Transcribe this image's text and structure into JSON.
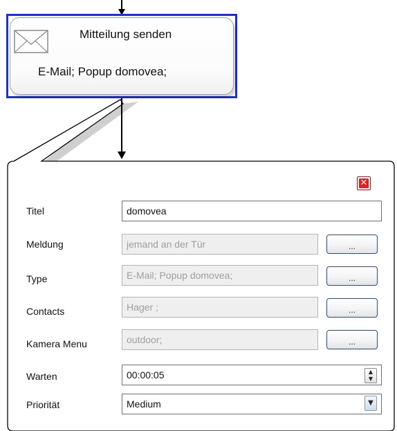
{
  "node": {
    "title": "Mitteilung senden",
    "subtitle": "E-Mail; Popup domovea;",
    "icon": "envelope-icon"
  },
  "panel": {
    "close_icon": "close-icon",
    "close_glyph": "✕",
    "rows": [
      {
        "label": "Titel",
        "value": "domovea"
      },
      {
        "label": "Meldung",
        "value": "jemand an der Tür",
        "button": "..."
      },
      {
        "label": "Type",
        "value": "E-Mail; Popup domovea;",
        "button": "..."
      },
      {
        "label": "Contacts",
        "value": "Hager  ;",
        "button": "..."
      },
      {
        "label": "Kamera Menu",
        "value": "outdoor;",
        "button": "..."
      },
      {
        "label": "Warten",
        "value": "00:00:05",
        "spinner_up": "▲",
        "spinner_down": "▼"
      },
      {
        "label": "Priorität",
        "value": "Medium",
        "dropdown_glyph": "▼"
      }
    ]
  },
  "colors": {
    "selection_border": "#1a2ee6",
    "button_border": "#234a9a",
    "close_red": "#e02020"
  }
}
